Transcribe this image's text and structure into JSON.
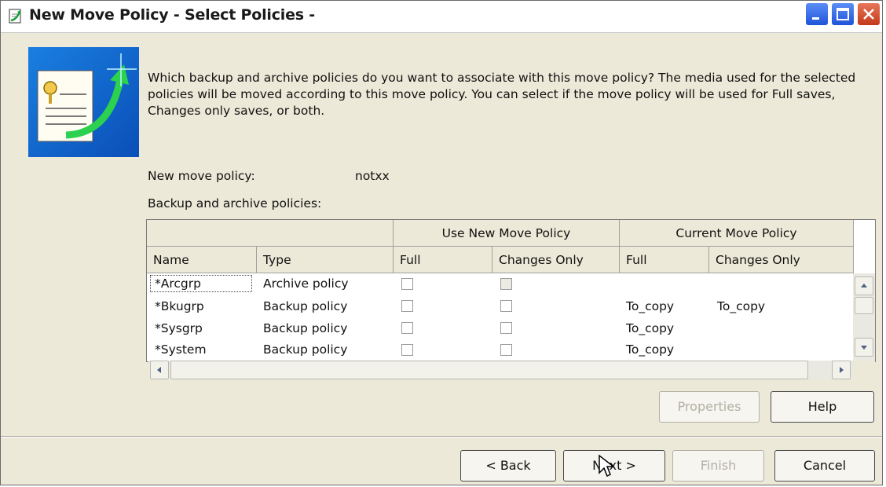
{
  "window": {
    "title": "New Move Policy - Select Policies -"
  },
  "intro_text": "Which backup and archive policies do you want to associate with this move policy?  The media used for the selected policies will be moved according to this move policy.  You can select if the move policy will be used for Full saves, Changes only saves, or both.",
  "move_policy": {
    "label": "New move policy:",
    "value": "notxx"
  },
  "table": {
    "label": "Backup and archive policies:",
    "group_headers": [
      "Use New Move Policy",
      "Current Move Policy"
    ],
    "columns": [
      "Name",
      "Type",
      "Full",
      "Changes Only",
      "Full",
      "Changes Only"
    ],
    "rows": [
      {
        "name": "*Arcgrp",
        "type": "Archive policy",
        "use_full": false,
        "use_changes": false,
        "cur_full": "",
        "cur_changes": ""
      },
      {
        "name": "*Bkugrp",
        "type": "Backup policy",
        "use_full": false,
        "use_changes": false,
        "cur_full": "To_copy",
        "cur_changes": "To_copy"
      },
      {
        "name": "*Sysgrp",
        "type": "Backup policy",
        "use_full": false,
        "use_changes": false,
        "cur_full": "To_copy",
        "cur_changes": ""
      },
      {
        "name": "*System",
        "type": "Backup policy",
        "use_full": false,
        "use_changes": false,
        "cur_full": "To_copy",
        "cur_changes": ""
      }
    ]
  },
  "buttons": {
    "properties": "Properties",
    "help": "Help",
    "back": "< Back",
    "next": "Next >",
    "finish": "Finish",
    "cancel": "Cancel"
  },
  "colors": {
    "title_close": "#c4391a",
    "title_buttons": "#1f54d8",
    "dialog_bg": "#ece9d8"
  }
}
